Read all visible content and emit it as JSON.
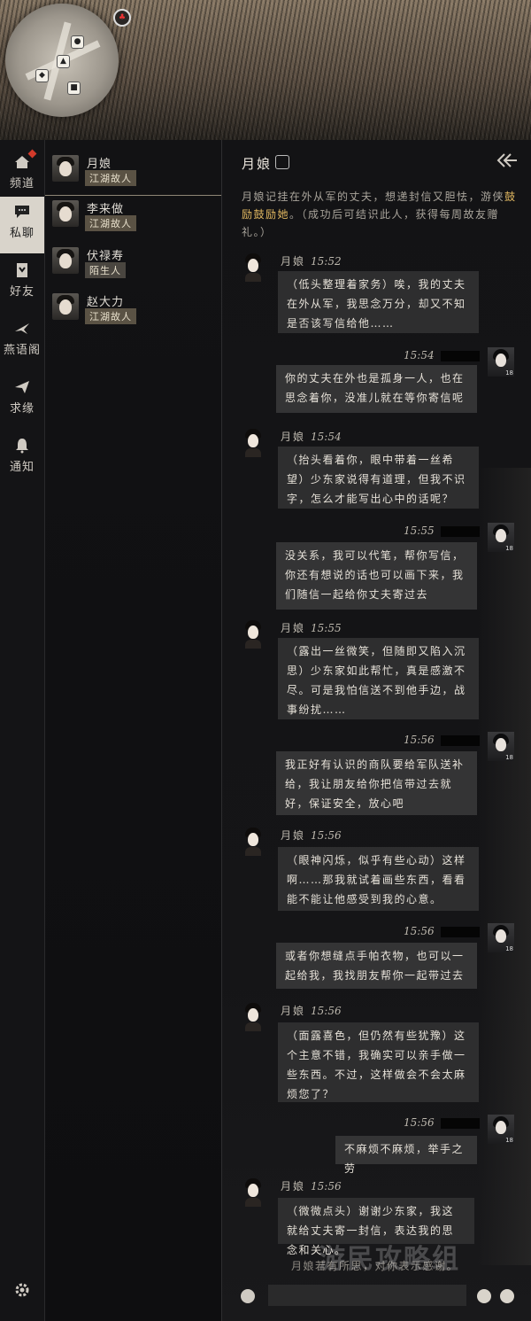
{
  "rail": {
    "items": [
      {
        "label": "频道",
        "icon": "house-icon"
      },
      {
        "label": "私聊",
        "icon": "chat-bubble-icon"
      },
      {
        "label": "好友",
        "icon": "friend-card-icon"
      },
      {
        "label": "燕语阁",
        "icon": "swallow-icon"
      },
      {
        "label": "求缘",
        "icon": "paper-plane-icon"
      },
      {
        "label": "通知",
        "icon": "bell-icon"
      }
    ],
    "settings_icon": "gear-icon"
  },
  "contacts": [
    {
      "name": "月娘",
      "tag": "江湖故人"
    },
    {
      "name": "李来做",
      "tag": "江湖故人"
    },
    {
      "name": "伏禄寿",
      "tag": "陌生人"
    },
    {
      "name": "赵大力",
      "tag": "江湖故人"
    }
  ],
  "chat": {
    "title": "月娘",
    "quest_text": "月娘记挂在外从军的丈夫，想递封信又胆怯，游侠",
    "quest_highlight": "鼓励鼓励她",
    "quest_tail": "。（成功后可结识此人，获得每周故友赠礼。）",
    "messages": [
      {
        "from": "npc",
        "name": "月娘",
        "time": "15:52",
        "text": "（低头整理着家务）唉，我的丈夫在外从军，我思念万分，却又不知是否该写信给他……"
      },
      {
        "from": "me",
        "time": "15:54",
        "text": "你的丈夫在外也是孤身一人，也在思念着你，没准儿就在等你寄信呢"
      },
      {
        "from": "npc",
        "name": "月娘",
        "time": "15:54",
        "text": "（抬头看着你，眼中带着一丝希望）少东家说得有道理，但我不识字，怎么才能写出心中的话呢？"
      },
      {
        "from": "me",
        "time": "15:55",
        "text": "没关系，我可以代笔，帮你写信，你还有想说的话也可以画下来，我们随信一起给你丈夫寄过去"
      },
      {
        "from": "npc",
        "name": "月娘",
        "time": "15:55",
        "text": "（露出一丝微笑，但随即又陷入沉思）少东家如此帮忙，真是感激不尽。可是我怕信送不到他手边，战事纷扰……"
      },
      {
        "from": "me",
        "time": "15:56",
        "text": "我正好有认识的商队要给军队送补给，我让朋友给你把信带过去就好，保证安全，放心吧"
      },
      {
        "from": "npc",
        "name": "月娘",
        "time": "15:56",
        "text": "（眼神闪烁，似乎有些心动）这样啊……那我就试着画些东西，看看能不能让他感受到我的心意。"
      },
      {
        "from": "me",
        "time": "15:56",
        "text": "或者你想缝点手帕衣物，也可以一起给我，我找朋友帮你一起带过去"
      },
      {
        "from": "npc",
        "name": "月娘",
        "time": "15:56",
        "text": "（面露喜色，但仍然有些犹豫）这个主意不错，我确实可以亲手做一些东西。不过，这样做会不会太麻烦您了？"
      },
      {
        "from": "me",
        "time": "15:56",
        "text": "不麻烦不麻烦，举手之劳"
      },
      {
        "from": "npc",
        "name": "月娘",
        "time": "15:56",
        "text": "（微微点头）谢谢少东家，我这就给丈夫寄一封信，表达我的思念和关心。"
      }
    ],
    "system_note": "月娘若有所思，对你表示感谢。",
    "my_level": "18"
  },
  "watermark": "游民攻略组"
}
